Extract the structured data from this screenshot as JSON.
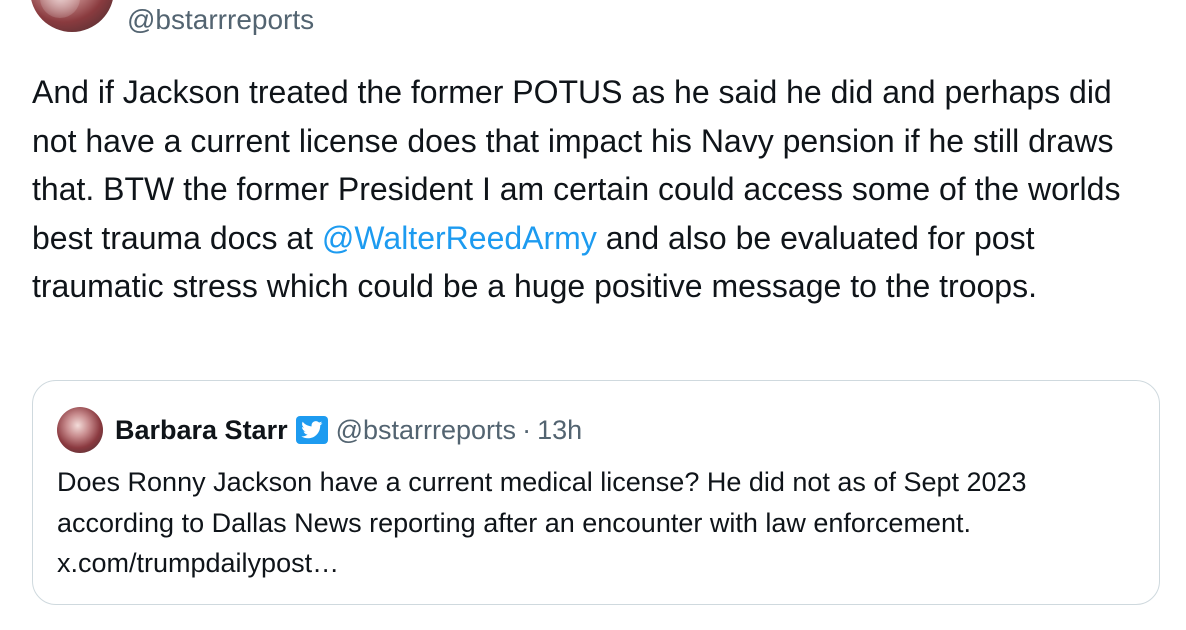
{
  "author": {
    "handle": "@bstarrreports"
  },
  "tweet": {
    "text_before_mention": "And if Jackson treated the former POTUS as he said he did and perhaps did not have a current license does that impact his Navy pension if he still draws that. BTW the former President I am certain could access some of the worlds best trauma docs at ",
    "mention": "@WalterReedArmy",
    "text_after_mention": " and also be evaluated for post traumatic stress which could be a huge positive message to the troops."
  },
  "quoted_tweet": {
    "name": "Barbara Starr",
    "verified_icon": "twitter-bird-icon",
    "handle": "@bstarrreports",
    "separator": "·",
    "time": "13h",
    "text": "Does Ronny Jackson have a current medical license? He did not as of Sept 2023 according to Dallas News reporting after an encounter with law enforcement. x.com/trumpdailypost…"
  },
  "colors": {
    "link": "#1d9bf0",
    "secondary_text": "#536471",
    "primary_text": "#0f1419",
    "border": "#cfd9de"
  }
}
